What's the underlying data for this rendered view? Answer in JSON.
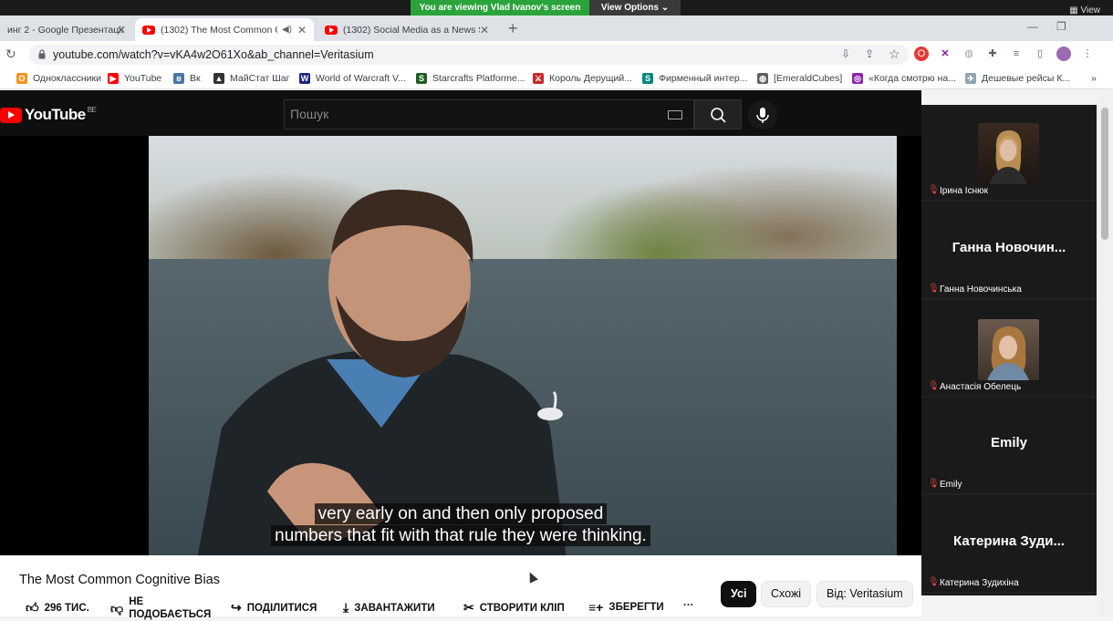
{
  "zoom": {
    "share_banner": "You are viewing Vlad Ivanov's screen",
    "view_options": "View Options",
    "right_label": "View"
  },
  "browser": {
    "tabs": [
      {
        "title": "инг 2 - Google Презентації",
        "active": false
      },
      {
        "title": "(1302) The Most Common C",
        "active": true
      },
      {
        "title": "(1302) Social Media as a News S",
        "active": false
      }
    ],
    "url": "youtube.com/watch?v=vKA4w2O61Xo&ab_channel=Veritasium",
    "bookmarks": [
      {
        "label": "Одноклассники",
        "icon_color": "#f7931e"
      },
      {
        "label": "YouTube",
        "icon_color": "#ff0000"
      },
      {
        "label": "Вк",
        "icon_color": "#4a76a8"
      },
      {
        "label": "МайСтат Шаг",
        "icon_color": "#333333"
      },
      {
        "label": "World of Warcraft V...",
        "icon_color": "#1a237e"
      },
      {
        "label": "Starcrafts Platforme...",
        "icon_color": "#1b5e20"
      },
      {
        "label": "Король Дерущий...",
        "icon_color": "#c62828"
      },
      {
        "label": "Фирменный интер...",
        "icon_color": "#00897b"
      },
      {
        "label": "[EmeraldCubes]",
        "icon_color": "#616161"
      },
      {
        "label": "«Когда смотрю на...",
        "icon_color": "#8e24aa"
      },
      {
        "label": "Дешевые рейсы К...",
        "icon_color": "#90a4ae"
      }
    ],
    "overflow": "»"
  },
  "youtube": {
    "logo": "YouTube",
    "region": "BE",
    "search_placeholder": "Пошук",
    "subtitle_line1": "very early on and then only proposed",
    "subtitle_line2": "numbers that fit with that rule they were thinking.",
    "video_title": "The Most Common Cognitive Bias",
    "actions": {
      "likes": "296 ТИС.",
      "dislike": "НЕ ПОДОБАЄТЬСЯ",
      "share": "ПОДІЛИТИСЯ",
      "download": "ЗАВАНТАЖИТИ",
      "clip": "СТВОРИТИ КЛІП",
      "save": "ЗБЕРЕГТИ",
      "more": "···"
    },
    "chips": [
      "Усі",
      "Схожі",
      "Від: Veritasium"
    ]
  },
  "participants": [
    {
      "name": "Ірина Існюк",
      "display": "",
      "has_photo": true
    },
    {
      "name": "Ганна Новочинська",
      "display": "Ганна Новочин...",
      "has_photo": false
    },
    {
      "name": "Анастасія Обелець",
      "display": "",
      "has_photo": true
    },
    {
      "name": "Emily",
      "display": "Emily",
      "has_photo": false
    },
    {
      "name": "Катерина Зудихіна",
      "display": "Катерина Зуди...",
      "has_photo": false
    }
  ]
}
